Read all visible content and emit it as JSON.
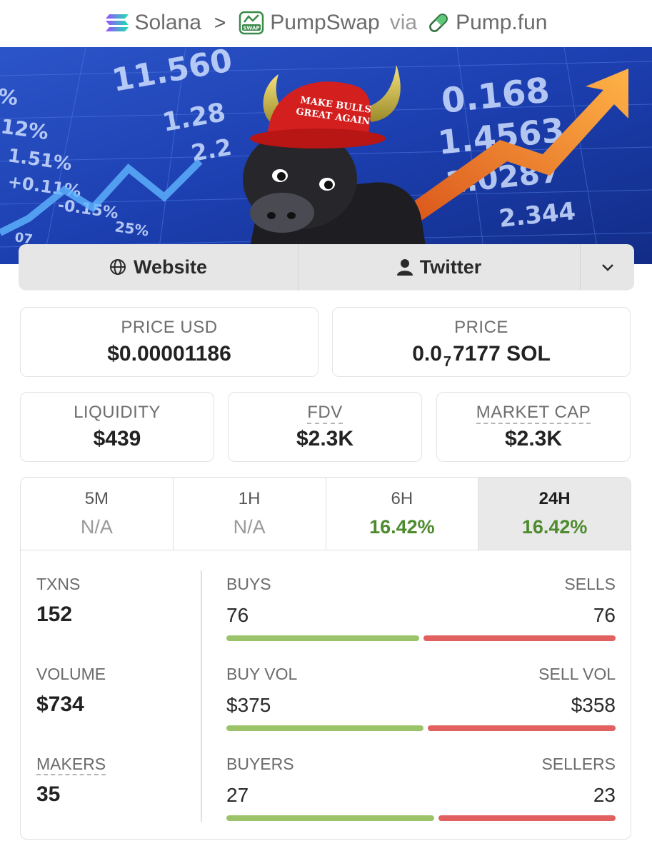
{
  "breadcrumb": {
    "chain": "Solana",
    "chain_icon": "solana-icon",
    "separator": ">",
    "dex": "PumpSwap",
    "dex_icon": "pumpswap-icon",
    "via": "via",
    "launchpad": "Pump.fun",
    "launchpad_icon": "pill-icon"
  },
  "banner": {
    "hat_text_line1": "MAKE BULLS",
    "hat_text_line2": "GREAT AGAIN",
    "ticker_left": [
      "11.560",
      "1.28",
      "2.2"
    ],
    "ticker_pct": [
      "%",
      "12%",
      "1.51%",
      "+0.11%",
      "-0.15%",
      "25%",
      "07"
    ],
    "ticker_right": [
      "0.168",
      "1.4563",
      "1.0287",
      "2.344"
    ]
  },
  "links": {
    "website_label": "Website",
    "twitter_label": "Twitter"
  },
  "price_usd": {
    "label": "PRICE USD",
    "value": "$0.00001186"
  },
  "price": {
    "label": "PRICE",
    "prefix": "0.0",
    "subscript": "7",
    "suffix": "7177 SOL"
  },
  "liquidity": {
    "label": "LIQUIDITY",
    "value": "$439"
  },
  "fdv": {
    "label": "FDV",
    "value": "$2.3K"
  },
  "market_cap": {
    "label": "MARKET CAP",
    "value": "$2.3K"
  },
  "timeframes": [
    {
      "label": "5M",
      "value": "N/A",
      "active": false
    },
    {
      "label": "1H",
      "value": "N/A",
      "active": false
    },
    {
      "label": "6H",
      "value": "16.42%",
      "active": false
    },
    {
      "label": "24H",
      "value": "16.42%",
      "active": true
    }
  ],
  "stats": {
    "txns": {
      "label": "TXNS",
      "value": "152"
    },
    "volume": {
      "label": "VOLUME",
      "value": "$734"
    },
    "makers": {
      "label": "MAKERS",
      "value": "35"
    },
    "buys": {
      "label": "BUYS",
      "value": "76",
      "fraction": 0.5
    },
    "sells": {
      "label": "SELLS",
      "value": "76",
      "fraction": 0.5
    },
    "buy_vol": {
      "label": "BUY VOL",
      "value": "$375",
      "fraction": 0.512
    },
    "sell_vol": {
      "label": "SELL VOL",
      "value": "$358",
      "fraction": 0.488
    },
    "buyers": {
      "label": "BUYERS",
      "value": "27",
      "fraction": 0.54
    },
    "sellers": {
      "label": "SELLERS",
      "value": "23",
      "fraction": 0.46
    }
  },
  "colors": {
    "positive": "#4e8a2e",
    "buy_bar": "#9bc46a",
    "sell_bar": "#e0615f"
  }
}
